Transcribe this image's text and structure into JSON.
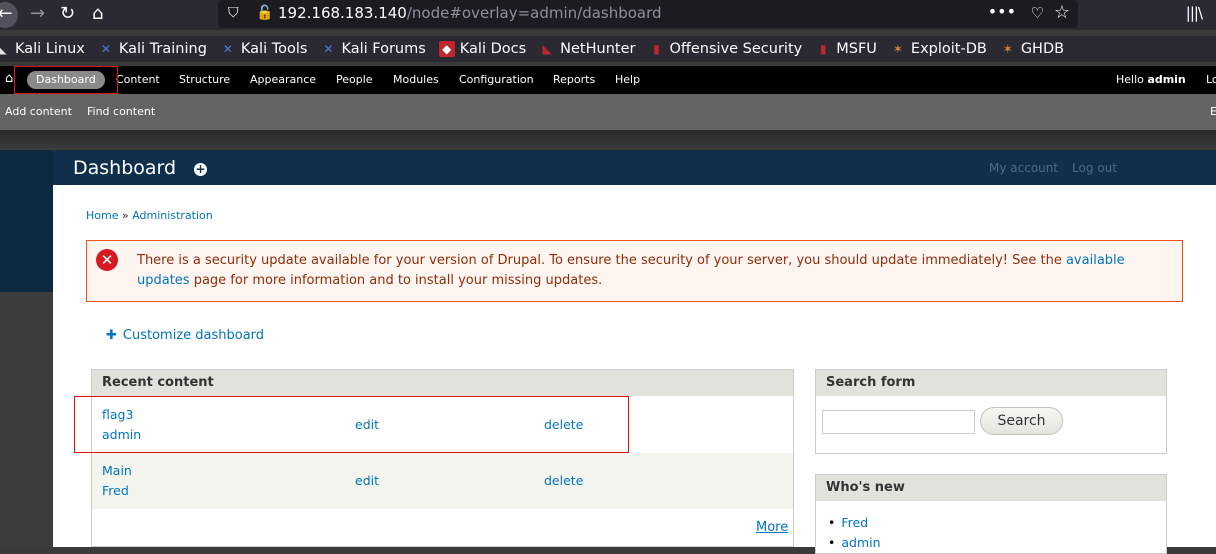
{
  "browser": {
    "url_host": "192.168.183.140",
    "url_path": "/node#overlay=admin/dashboard",
    "icons": {
      "back": "arrow-left-icon",
      "forward": "arrow-right-icon",
      "reload": "reload-icon",
      "home": "home-icon",
      "shield": "tracking-shield-icon",
      "insecure": "insecure-lock-icon",
      "more": "page-actions-icon",
      "pocket": "pocket-icon",
      "bookmark": "star-icon",
      "library": "library-icon"
    },
    "bookmarks": [
      {
        "label": "Kali Linux",
        "icon": "kali-icon"
      },
      {
        "label": "Kali Training",
        "icon": "kali-training-icon"
      },
      {
        "label": "Kali Tools",
        "icon": "kali-tools-icon"
      },
      {
        "label": "Kali Forums",
        "icon": "kali-forums-icon"
      },
      {
        "label": "Kali Docs",
        "icon": "kali-docs-icon"
      },
      {
        "label": "NetHunter",
        "icon": "nethunter-icon"
      },
      {
        "label": "Offensive Security",
        "icon": "offsec-icon"
      },
      {
        "label": "MSFU",
        "icon": "msfu-icon"
      },
      {
        "label": "Exploit-DB",
        "icon": "exploitdb-icon"
      },
      {
        "label": "GHDB",
        "icon": "ghdb-icon"
      }
    ]
  },
  "toolbar": {
    "items": [
      "Dashboard",
      "Content",
      "Structure",
      "Appearance",
      "People",
      "Modules",
      "Configuration",
      "Reports",
      "Help"
    ],
    "hello_prefix": "Hello ",
    "username": "admin",
    "logout_partial": "Lo"
  },
  "shortcuts": {
    "items": [
      "Add content",
      "Find content"
    ],
    "edge_partial": "E"
  },
  "overlay": {
    "title": "Dashboard",
    "header_links": [
      "My account",
      "Log out"
    ]
  },
  "breadcrumb": {
    "items": [
      "Home",
      "Administration"
    ],
    "separator": " » "
  },
  "alert": {
    "text_before": "There is a security update available for your version of Drupal. To ensure the security of your server, you should update immediately! See the ",
    "link_text": "available updates",
    "text_after": " page for more information and to install your missing updates."
  },
  "customize": {
    "label": "Customize dashboard"
  },
  "recent_content": {
    "title": "Recent content",
    "rows": [
      {
        "title": "flag3",
        "author": "admin",
        "edit": "edit",
        "delete": "delete"
      },
      {
        "title": "Main",
        "author": "Fred",
        "edit": "edit",
        "delete": "delete"
      }
    ],
    "more": "More"
  },
  "search_form": {
    "title": "Search form",
    "value": "",
    "button": "Search"
  },
  "whos_new": {
    "title": "Who's new",
    "users": [
      "Fred",
      "admin"
    ]
  },
  "colors": {
    "link": "#0074bd",
    "alert_border": "#ed541d",
    "alert_bg": "#fef5f1",
    "alert_text": "#8c2e0b",
    "annotation": "#dd1111"
  }
}
